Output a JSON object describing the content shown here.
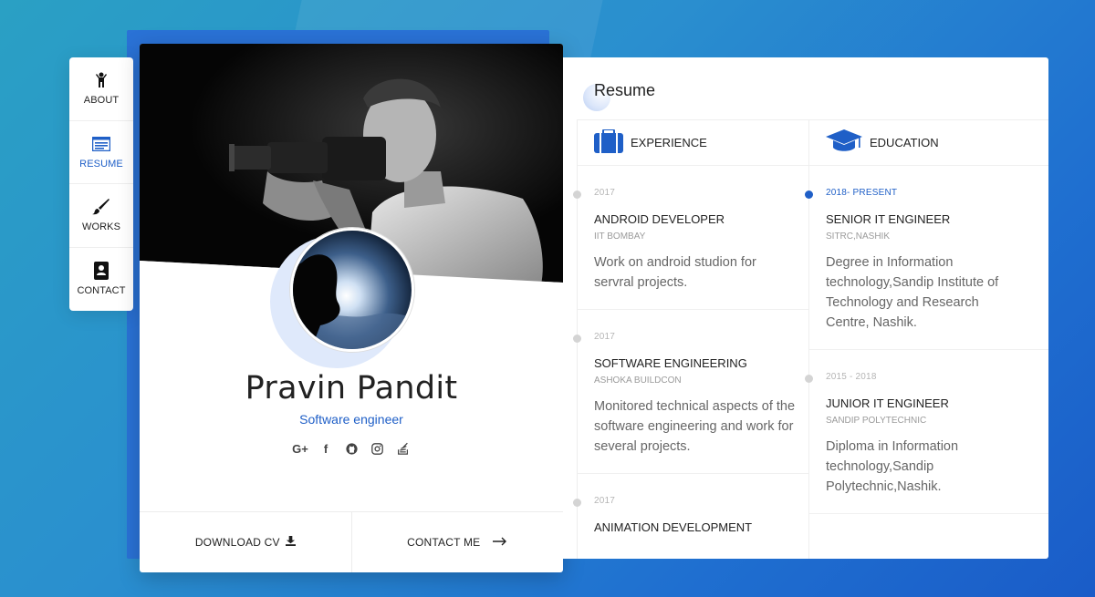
{
  "nav": {
    "items": [
      {
        "label": "ABOUT",
        "icon": "person-icon"
      },
      {
        "label": "RESUME",
        "icon": "list-card-icon",
        "active": true
      },
      {
        "label": "WORKS",
        "icon": "paintbrush-icon"
      },
      {
        "label": "CONTACT",
        "icon": "contact-book-icon"
      }
    ]
  },
  "profile": {
    "name": "Pravin Pandit",
    "role": "Software engineer",
    "socials": [
      "google-plus-icon",
      "facebook-icon",
      "github-icon",
      "instagram-icon",
      "stack-overflow-icon"
    ],
    "download_label": "DOWNLOAD CV",
    "contact_label": "CONTACT ME"
  },
  "resume": {
    "title": "Resume",
    "experience": {
      "heading": "EXPERIENCE",
      "entries": [
        {
          "year": "2017",
          "title": "ANDROID DEVELOPER",
          "org": "IIT BOMBAY",
          "desc": "Work on android studion for servral projects."
        },
        {
          "year": "2017",
          "title": "SOFTWARE ENGINEERING",
          "org": "ASHOKA BUILDCON",
          "desc": "Monitored technical aspects of the software engineering and work for several projects."
        },
        {
          "year": "2017",
          "title": "ANIMATION DEVELOPMENT",
          "org": "",
          "desc": ""
        }
      ]
    },
    "education": {
      "heading": "EDUCATION",
      "entries": [
        {
          "year": "2018- PRESENT",
          "title": "SENIOR IT ENGINEER",
          "org": "SITRC,NASHIK",
          "desc": "Degree in Information technology,Sandip Institute of Technology and Research Centre, Nashik."
        },
        {
          "year": "2015 - 2018",
          "title": "JUNIOR IT ENGINEER",
          "org": "SANDIP POLYTECHNIC",
          "desc": "Diploma in Information technology,Sandip Polytechnic,Nashik."
        }
      ]
    }
  },
  "colors": {
    "accent": "#1f5fc7",
    "background": "#2a8fcf"
  }
}
